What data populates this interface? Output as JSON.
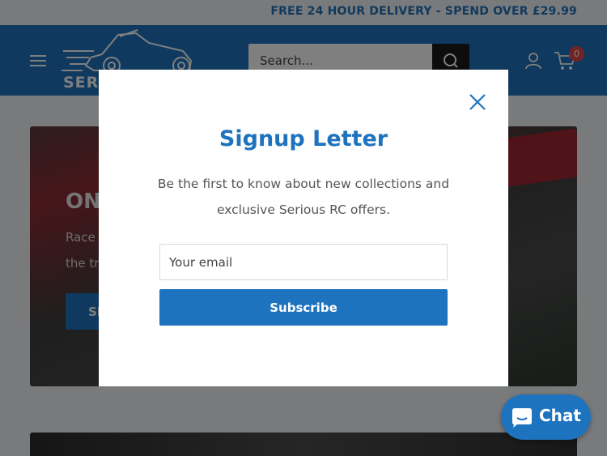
{
  "announcement": {
    "text": "FREE 24 HOUR DELIVERY - SPEND OVER £29.99"
  },
  "header": {
    "logo_text": "SERIOUS RC",
    "search": {
      "placeholder": "Search..."
    },
    "cart_count": "0",
    "icons": [
      "menu-icon",
      "search-icon",
      "account-icon",
      "cart-icon"
    ]
  },
  "hero": {
    "title": "ON-",
    "text_line1": "Race",
    "text_line2": "the tra",
    "button_label": "SH"
  },
  "modal": {
    "title": "Signup Letter",
    "description": "Be the first to know about new collections and exclusive Serious RC offers.",
    "email_placeholder": "Your email",
    "subscribe_label": "Subscribe",
    "close_icon": "close-icon"
  },
  "chat": {
    "label": "Chat",
    "icon": "chat-bubble-icon"
  },
  "colors": {
    "brand": "#1e73be",
    "badge": "#e9464a",
    "overlay": "rgba(0,0,0,0.5)"
  }
}
